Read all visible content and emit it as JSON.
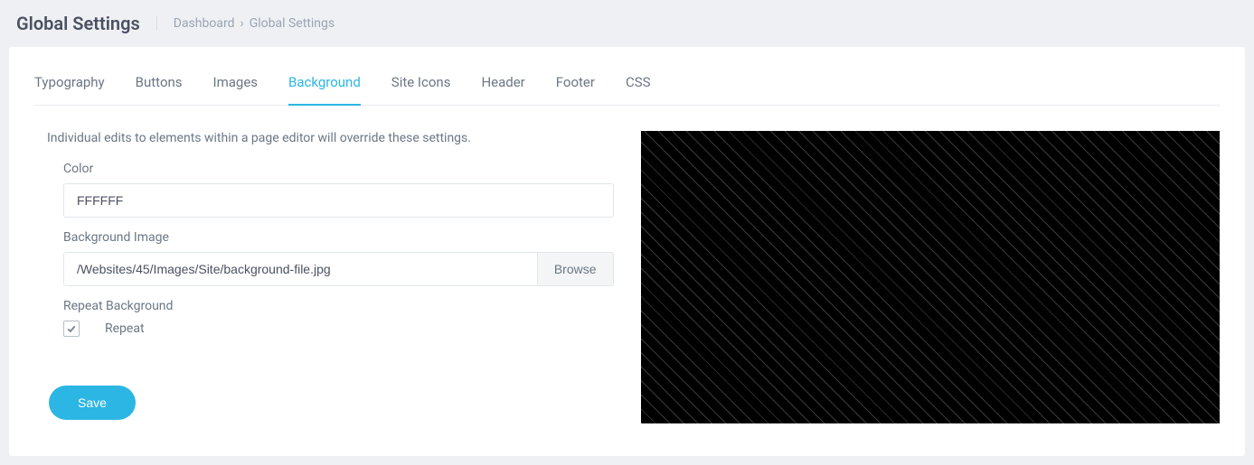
{
  "header": {
    "title": "Global Settings"
  },
  "breadcrumb": {
    "root": "Dashboard",
    "current": "Global Settings"
  },
  "tabs": [
    {
      "label": "Typography",
      "active": false
    },
    {
      "label": "Buttons",
      "active": false
    },
    {
      "label": "Images",
      "active": false
    },
    {
      "label": "Background",
      "active": true
    },
    {
      "label": "Site Icons",
      "active": false
    },
    {
      "label": "Header",
      "active": false
    },
    {
      "label": "Footer",
      "active": false
    },
    {
      "label": "CSS",
      "active": false
    }
  ],
  "form": {
    "note": "Individual edits to elements within a page editor will override these settings.",
    "color_label": "Color",
    "color_value": "FFFFFF",
    "bgimage_label": "Background Image",
    "bgimage_value": "/Websites/45/Images/Site/background-file.jpg",
    "browse_label": "Browse",
    "repeat_section_label": "Repeat Background",
    "repeat_checkbox_label": "Repeat",
    "repeat_checked": true,
    "save_label": "Save"
  },
  "colors": {
    "accent": "#2cb6e3",
    "page_bg": "#eef0f4",
    "text_muted": "#6b7785"
  }
}
